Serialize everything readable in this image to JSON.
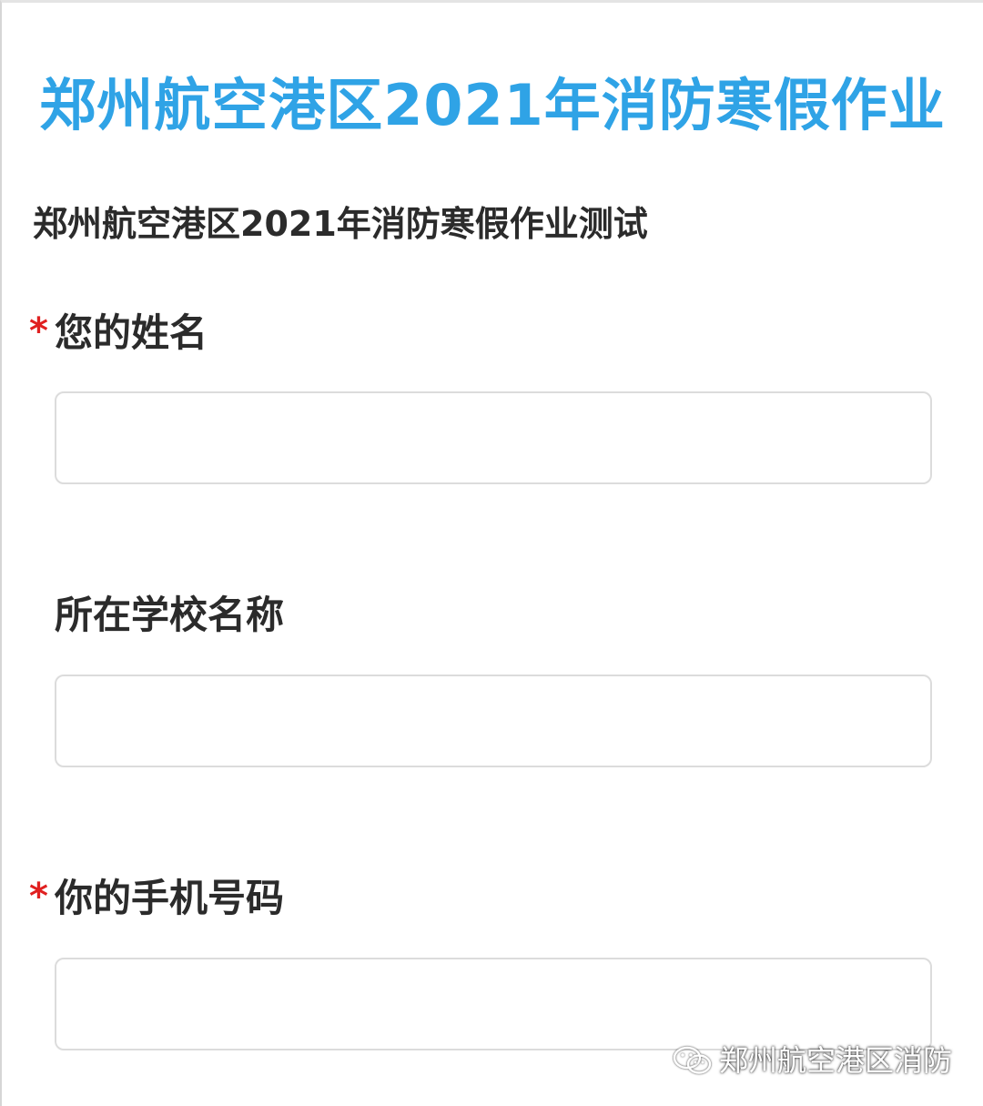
{
  "form": {
    "title": "郑州航空港区2021年消防寒假作业",
    "description": "郑州航空港区2021年消防寒假作业测试",
    "questions": [
      {
        "label": "您的姓名",
        "required_mark": "*",
        "value": "",
        "placeholder": ""
      },
      {
        "label": "所在学校名称",
        "required_mark": "",
        "value": "",
        "placeholder": ""
      },
      {
        "label": "你的手机号码",
        "required_mark": "*",
        "value": "",
        "placeholder": ""
      }
    ]
  },
  "watermark": {
    "icon": "wechat-icon",
    "text": "郑州航空港区消防"
  },
  "colors": {
    "title": "#2fa3e6",
    "required": "#e02020",
    "text": "#2b2b2b",
    "input_border": "#dcdcdc"
  }
}
